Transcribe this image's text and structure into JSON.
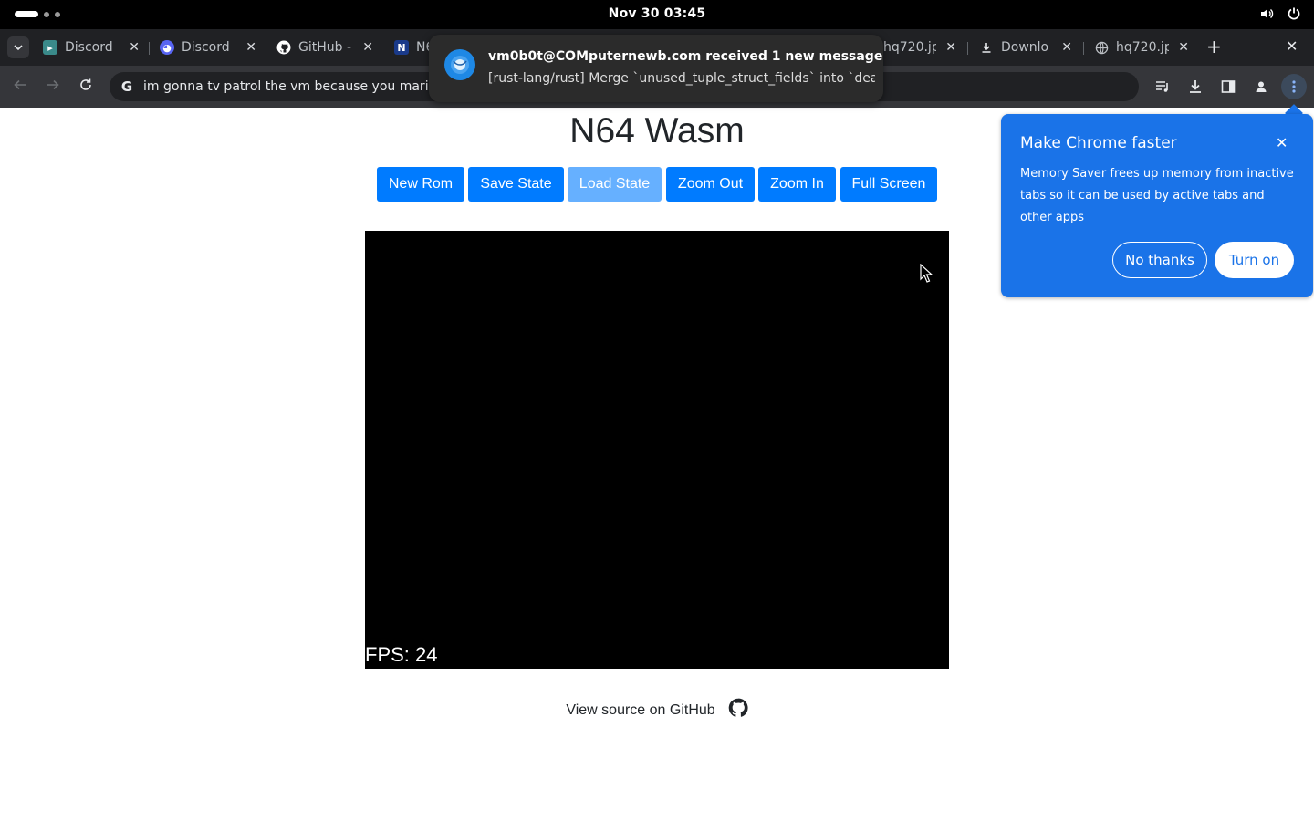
{
  "system": {
    "clock": "Nov 30  03:45",
    "icons": [
      "volume-icon",
      "power-icon"
    ]
  },
  "tabs": [
    {
      "title": "Discord",
      "favicon": "discord-app-icon",
      "favicon_color": "#3a8a8a"
    },
    {
      "title": "Discord",
      "favicon": "discord-icon",
      "favicon_color": "#5865f2"
    },
    {
      "title": "GitHub -",
      "favicon": "github-icon",
      "favicon_color": "#ffffff"
    },
    {
      "title": "N6",
      "favicon": "n-icon",
      "favicon_color": "#1a3a8a"
    },
    {
      "title": "hq720.jp",
      "favicon": "none"
    },
    {
      "title": "Downlo",
      "favicon": "download-icon"
    },
    {
      "title": "hq720.jp",
      "favicon": "globe-icon"
    }
  ],
  "omnibox": {
    "text": "im gonna tv patrol the vm because you mariof%gge"
  },
  "notification": {
    "title": "vm0b0t@COMputernewb.com received 1 new message",
    "body": "[rust-lang/rust] Merge `unused_tuple_struct_fields` into `dead..."
  },
  "page": {
    "title": "N64 Wasm",
    "buttons": {
      "new_rom": "New Rom",
      "save_state": "Save State",
      "load_state": "Load State",
      "zoom_out": "Zoom Out",
      "zoom_in": "Zoom In",
      "full_screen": "Full Screen"
    },
    "fps": "FPS: 24",
    "source_link": "View source on GitHub"
  },
  "promo": {
    "title": "Make Chrome faster",
    "body": "Memory Saver frees up memory from inactive tabs so it can be used by active tabs and other apps",
    "no_thanks": "No thanks",
    "turn_on": "Turn on"
  },
  "colors": {
    "accent_button": "#007bff",
    "promo_blue": "#1a73e8"
  }
}
